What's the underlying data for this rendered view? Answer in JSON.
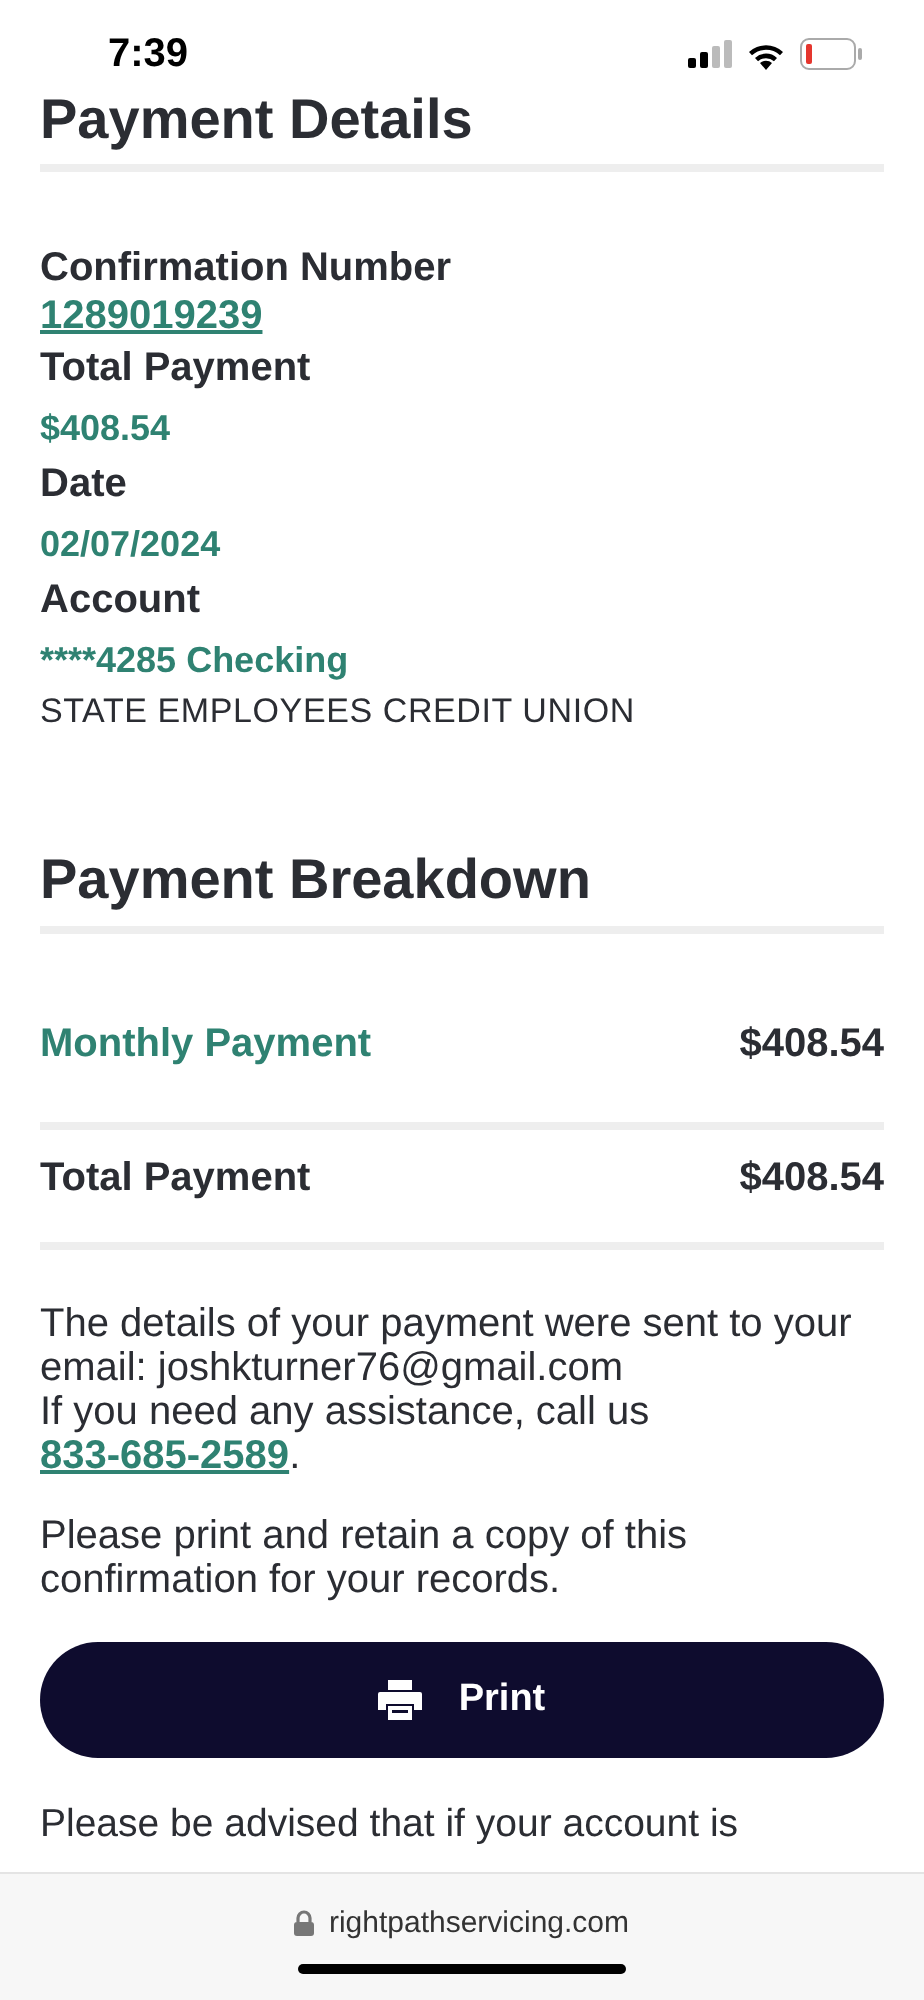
{
  "status_bar": {
    "time": "7:39"
  },
  "section_title": "Payment Details",
  "details": [
    {
      "label": "Confirmation Number",
      "value": "1289019239",
      "kind": "link"
    },
    {
      "label": "Total Payment",
      "value": "$408.54",
      "kind": "plain"
    },
    {
      "label": "Date",
      "value": "02/07/2024",
      "kind": "plain"
    },
    {
      "label": "Account",
      "value": "****4285 Checking",
      "kind": "plain",
      "note": "STATE EMPLOYEES CREDIT UNION"
    }
  ],
  "breakdown": {
    "title": "Payment Breakdown",
    "rows": [
      {
        "label": "Monthly Payment",
        "amount": "$408.54",
        "kind": "item"
      },
      {
        "label": "Total Payment",
        "amount": "$408.54",
        "kind": "total"
      }
    ]
  },
  "email_note": "The details of your payment were sent to your email: joshkturner76@gmail.com",
  "assist": {
    "text": "If you need any assistance, call us",
    "phone": "833-685-2589",
    "suffix": "."
  },
  "retain_note": "Please print and retain a copy of this confirmation for your records.",
  "print_button": "Print",
  "advisory": "Please be advised that if your account is",
  "url_bar": "rightpathservicing.com"
}
